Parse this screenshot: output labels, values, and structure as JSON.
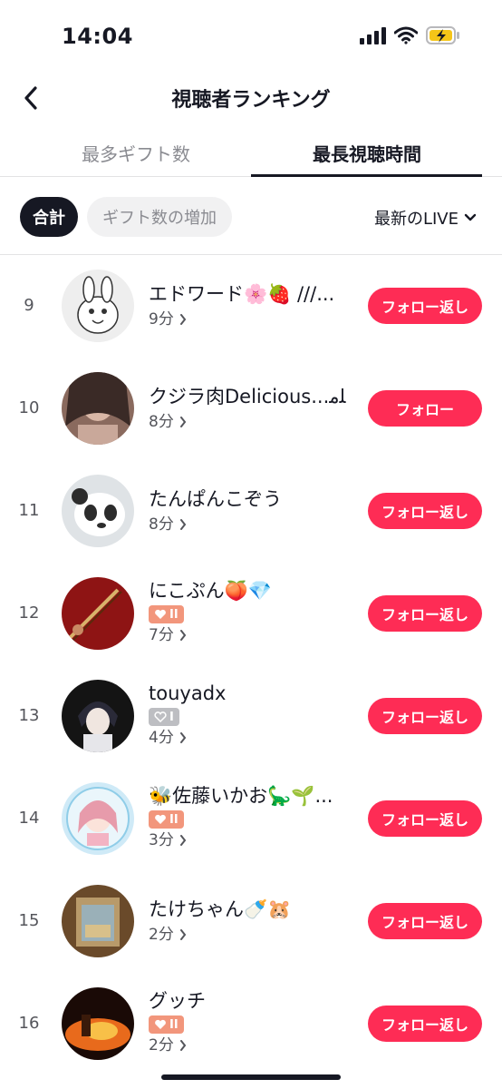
{
  "status_bar": {
    "time": "14:04",
    "icons": [
      "signal-icon",
      "wifi-icon",
      "battery-charging-icon"
    ]
  },
  "header": {
    "title": "視聴者ランキング",
    "back_icon": "chevron-left-icon"
  },
  "tabs": [
    {
      "label": "最多ギフト数",
      "active": false
    },
    {
      "label": "最長視聴時間",
      "active": true
    }
  ],
  "filters": {
    "total_label": "合計",
    "gift_increase_label": "ギフト数の増加",
    "live_select_label": "最新のLIVE",
    "live_select_icon": "chevron-down-icon"
  },
  "colors": {
    "accent": "#fe2c55",
    "badge_orange": "#f2967c",
    "badge_gray": "#bdbec2",
    "text": "#161823"
  },
  "viewers": [
    {
      "rank": "9",
      "name": "エドワード🌸🍓 ///...",
      "badge": "",
      "duration": "9分",
      "button": "フォロー返し"
    },
    {
      "rank": "10",
      "name": "クジラ肉Delicious...ﻠﻣ",
      "badge": "",
      "duration": "8分",
      "button": "フォロー"
    },
    {
      "rank": "11",
      "name": "たんぱんこぞう",
      "badge": "",
      "duration": "8分",
      "button": "フォロー返し"
    },
    {
      "rank": "12",
      "name": "にこぷん🍑💎",
      "badge": "II",
      "badge_color": "orange",
      "duration": "7分",
      "button": "フォロー返し"
    },
    {
      "rank": "13",
      "name": "touyadx",
      "badge": "I",
      "badge_color": "gray",
      "duration": "4分",
      "button": "フォロー返し"
    },
    {
      "rank": "14",
      "name": "🐝佐藤いかお🦕🌱...",
      "badge": "II",
      "badge_color": "orange",
      "duration": "3分",
      "button": "フォロー返し"
    },
    {
      "rank": "15",
      "name": "たけちゃん🍼🐹",
      "badge": "",
      "duration": "2分",
      "button": "フォロー返し"
    },
    {
      "rank": "16",
      "name": "グッチ",
      "badge": "II",
      "badge_color": "orange",
      "duration": "2分",
      "button": "フォロー返し"
    }
  ]
}
